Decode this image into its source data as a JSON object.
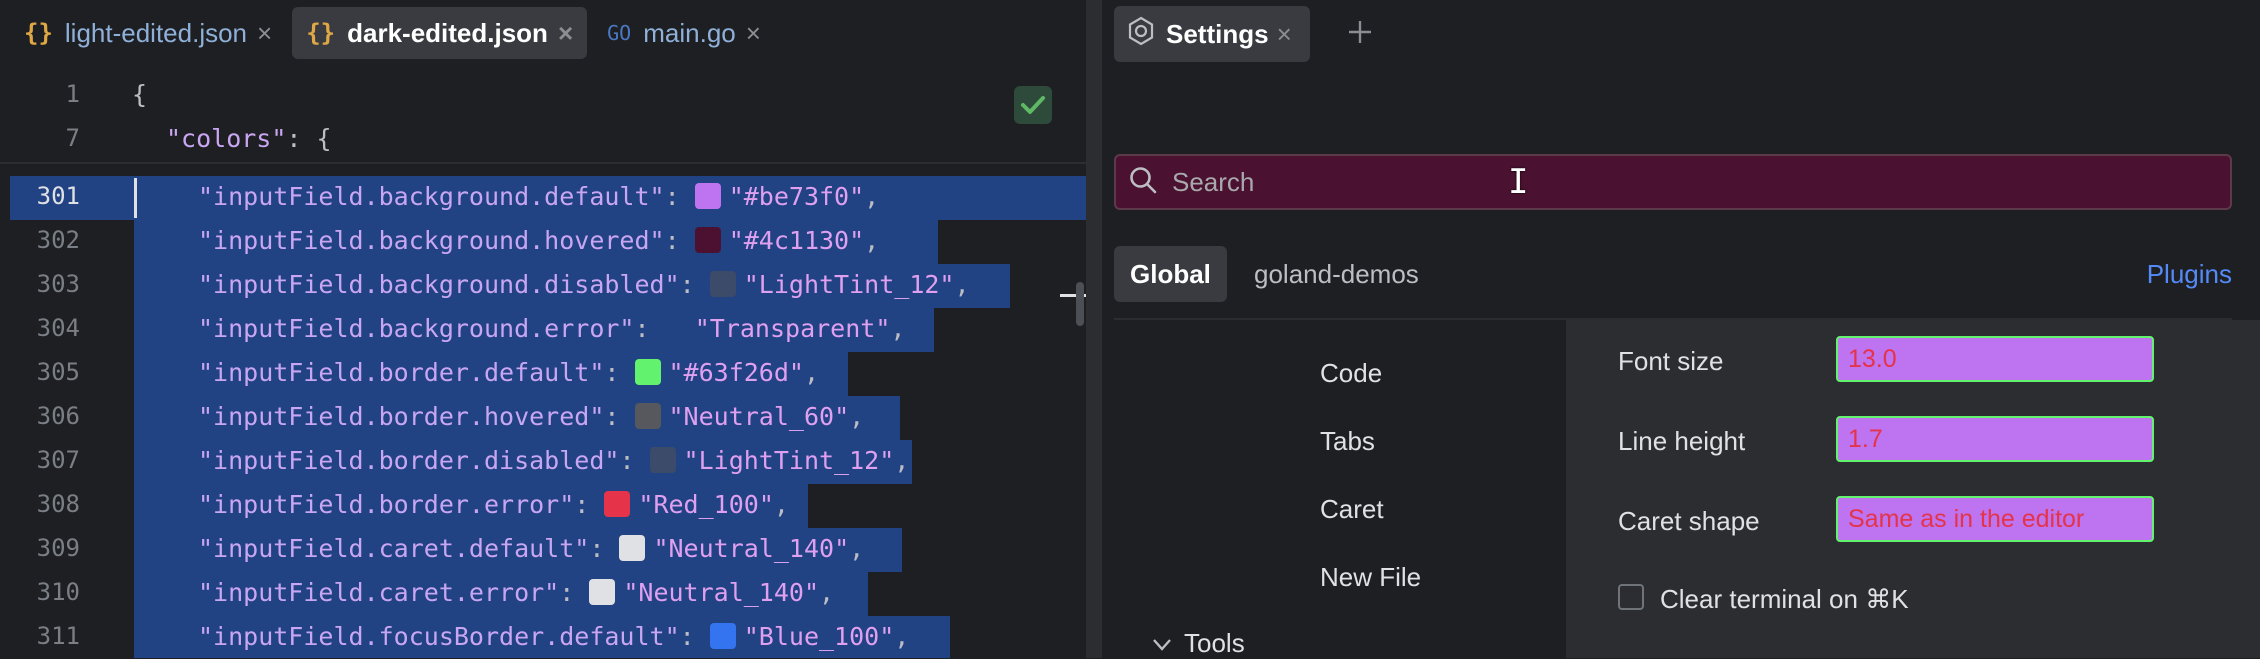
{
  "editor": {
    "tabs": [
      {
        "icon": "{}",
        "label": "light-edited.json",
        "active": false
      },
      {
        "icon": "{}",
        "label": "dark-edited.json",
        "active": true
      },
      {
        "icon": "GO",
        "label": "main.go",
        "active": false
      }
    ],
    "close_glyph": "×",
    "sticky": [
      {
        "num": "1",
        "text": "{"
      },
      {
        "num": "7",
        "key": "\"colors\"",
        "rest": ": {"
      }
    ],
    "lines": [
      {
        "num": "301",
        "key": "\"inputField.background.default\"",
        "swatch": "#be73f0",
        "value": "\"#be73f0\"",
        "tail": ","
      },
      {
        "num": "302",
        "key": "\"inputField.background.hovered\"",
        "swatch": "#4c1130",
        "value": "\"#4c1130\"",
        "tail": ","
      },
      {
        "num": "303",
        "key": "\"inputField.background.disabled\"",
        "swatch": "#3d4b6b",
        "value": "\"LightTint_12\"",
        "tail": ","
      },
      {
        "num": "304",
        "key": "\"inputField.background.error\"",
        "swatch": "",
        "value": "\"Transparent\"",
        "tail": ","
      },
      {
        "num": "305",
        "key": "\"inputField.border.default\"",
        "swatch": "#63f26d",
        "value": "\"#63f26d\"",
        "tail": ","
      },
      {
        "num": "306",
        "key": "\"inputField.border.hovered\"",
        "swatch": "#56585d",
        "value": "\"Neutral_60\"",
        "tail": ","
      },
      {
        "num": "307",
        "key": "\"inputField.border.disabled\"",
        "swatch": "#3d4b6b",
        "value": "\"LightTint_12\"",
        "tail": ","
      },
      {
        "num": "308",
        "key": "\"inputField.border.error\"",
        "swatch": "#e5334a",
        "value": "\"Red_100\"",
        "tail": ","
      },
      {
        "num": "309",
        "key": "\"inputField.caret.default\"",
        "swatch": "#dfe1e5",
        "value": "\"Neutral_140\"",
        "tail": ","
      },
      {
        "num": "310",
        "key": "\"inputField.caret.error\"",
        "swatch": "#dfe1e5",
        "value": "\"Neutral_140\"",
        "tail": ","
      },
      {
        "num": "311",
        "key": "\"inputField.focusBorder.default\"",
        "swatch": "#3574f0",
        "value": "\"Blue_100\"",
        "tail": ","
      }
    ]
  },
  "settings": {
    "tab_label": "Settings",
    "search_placeholder": "Search",
    "scopes": [
      "Global",
      "goland-demos"
    ],
    "plugins_label": "Plugins",
    "nav": [
      "Code",
      "Tabs",
      "Caret",
      "New File"
    ],
    "nav_group": "Tools",
    "rows": [
      {
        "label": "Font size",
        "value": "13.0"
      },
      {
        "label": "Line height",
        "value": "1.7"
      },
      {
        "label": "Caret shape",
        "value": "Same as in the editor"
      }
    ],
    "checkbox_label": "Clear terminal on ⌘K"
  },
  "colors": {
    "selection": "#214283",
    "accent": "#548af7",
    "field_bg": "#be73f0",
    "field_border": "#63f26d",
    "field_text": "#e5334a",
    "search_bg": "#4a1130"
  }
}
